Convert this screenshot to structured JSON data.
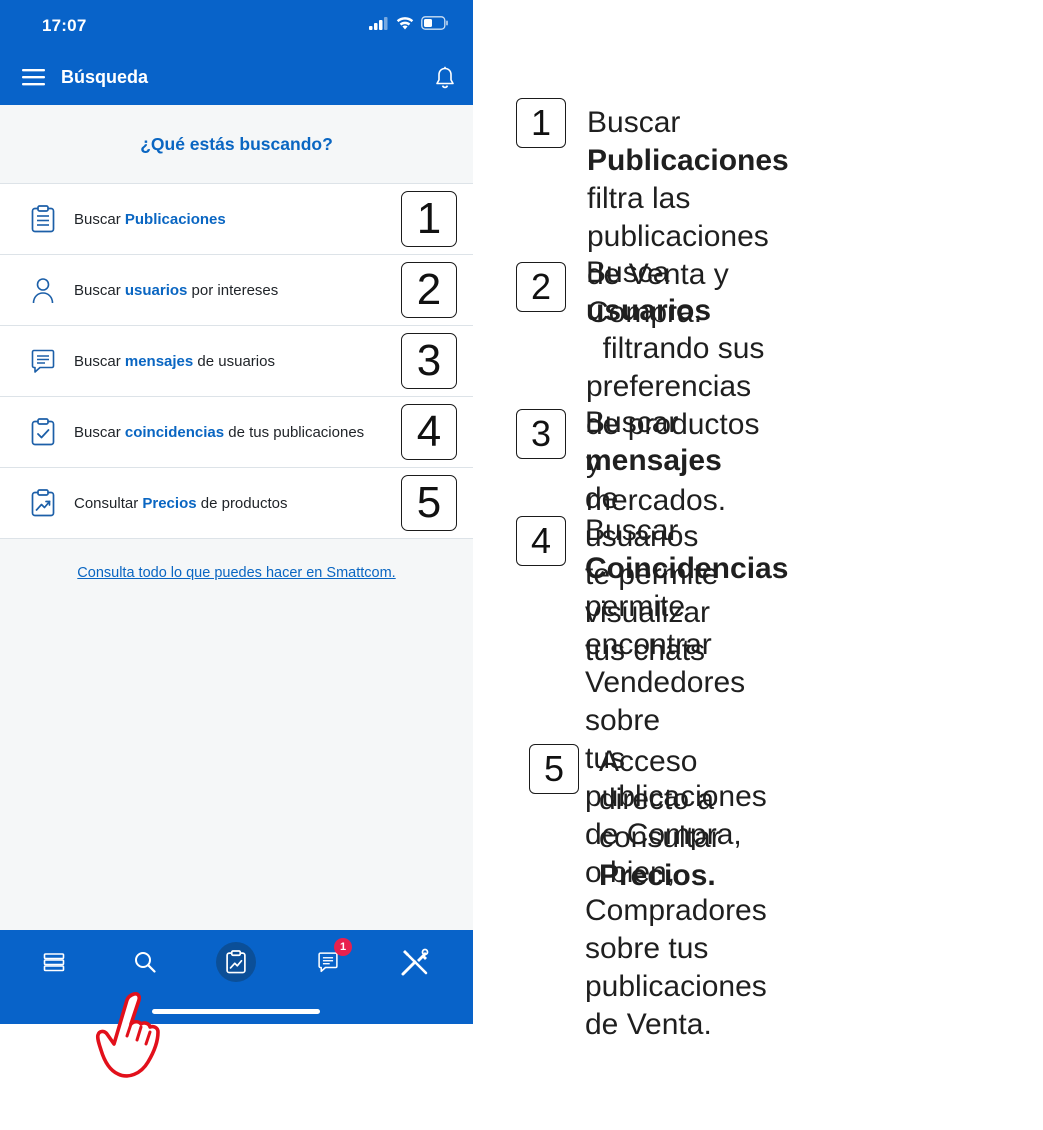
{
  "status_bar": {
    "time": "17:07"
  },
  "header": {
    "title": "Búsqueda"
  },
  "question": "¿Qué estás buscando?",
  "rows": [
    {
      "pre": "Buscar ",
      "kw": "Publicaciones",
      "post": "",
      "number": "1"
    },
    {
      "pre": "Buscar ",
      "kw": "usuarios",
      "post": " por intereses",
      "number": "2"
    },
    {
      "pre": "Buscar ",
      "kw": "mensajes",
      "post": " de usuarios",
      "number": "3"
    },
    {
      "pre": "Buscar ",
      "kw": "coincidencias",
      "post": " de tus publicaciones",
      "number": "4"
    },
    {
      "pre": "Consultar ",
      "kw": "Precios",
      "post": " de productos",
      "number": "5"
    }
  ],
  "help_link": "Consulta todo lo que puedes hacer en Smattcom.",
  "tabbar": {
    "icons": [
      "list-icon",
      "search-icon",
      "price-chart-icon",
      "messages-icon",
      "tools-icon"
    ],
    "messages_badge": "1"
  },
  "explanations": [
    {
      "number": "1",
      "line1_pre": "Buscar ",
      "line1_bold": "Publicaciones",
      "line1_post": " filtra las",
      "line2": "publicaciones de Venta y",
      "line3": "Compra."
    },
    {
      "number": "2",
      "line1_pre": "Busca ",
      "line1_bold": "usuarios",
      "line1_post": "  filtrando sus",
      "line2": "preferencias de productos y",
      "line3": "mercados."
    },
    {
      "number": "3",
      "line1_pre": "Buscar ",
      "line1_bold": "mensajes",
      "line1_post": " de usuarios",
      "line2": "te permite visualizar tus chats"
    },
    {
      "number": "4",
      "line1_pre": "Buscar ",
      "line1_bold": "Coincidencias",
      "line1_post": " permite",
      "line2": "encontrar Vendedores sobre",
      "line3": "tus publicaciones de Compra,",
      "line4": "o bien, Compradores sobre tus",
      "line5": "publicaciones de Venta."
    },
    {
      "number": "5",
      "line1": "Acceso directo a consultar",
      "line2_bold": "Precios."
    }
  ],
  "colors": {
    "primary": "#0863c9",
    "link": "#0a66c2",
    "badge": "#e8204e",
    "hand": "#e2101b"
  }
}
